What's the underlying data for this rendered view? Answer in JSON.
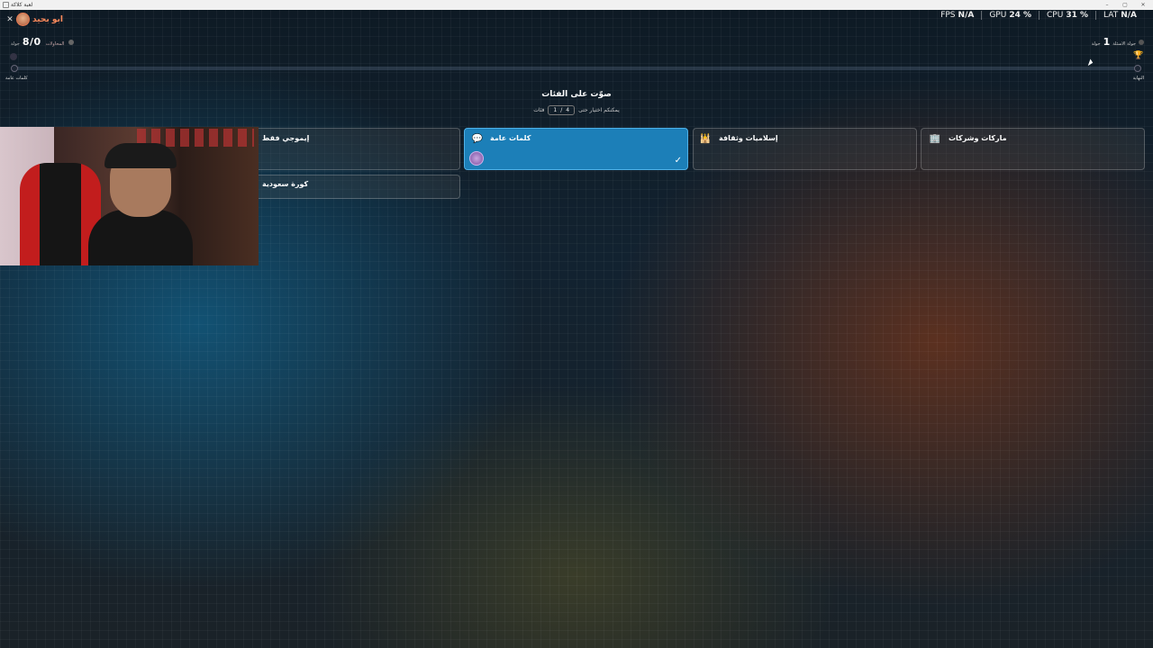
{
  "window": {
    "title": "لعبة كلاكة"
  },
  "user": {
    "name": "ابو بحيد"
  },
  "score": {
    "value": "8/0",
    "label": "المحاولات",
    "unit": "جولة"
  },
  "perf": [
    {
      "label": "FPS",
      "value": "N/A"
    },
    {
      "label": "GPU",
      "value": "24 %"
    },
    {
      "label": "CPU",
      "value": "31 %"
    },
    {
      "label": "LAT",
      "value": "N/A"
    }
  ],
  "round": {
    "number": "1",
    "label": "جولة",
    "sublabel": "جولة الاسئلة"
  },
  "progress": {
    "fraction": 0.0,
    "left_label": "كلمات عامة",
    "right_label": "النهاية"
  },
  "vote": {
    "title": "صوّت على الفئات",
    "subtitle": "يمكنكم اختيار حتى",
    "count_current": "1",
    "count_max": "4",
    "count_unit": "فئات"
  },
  "categories": [
    {
      "name": "ماركات وشركات",
      "icon": "building-icon",
      "selected": false
    },
    {
      "name": "إسلاميات وثقافة",
      "icon": "mosque-icon",
      "selected": false
    },
    {
      "name": "كلمات عامة",
      "icon": "speech-bubble-icon",
      "selected": true
    },
    {
      "name": "إيموجي فقط",
      "icon": "",
      "selected": false
    },
    {
      "name": "كورة سعودية",
      "icon": "",
      "selected": false
    }
  ]
}
